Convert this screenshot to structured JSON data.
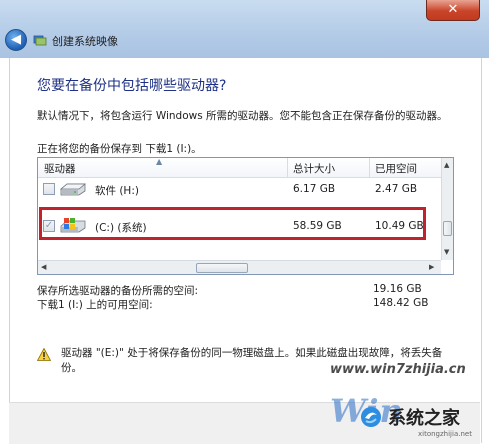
{
  "window": {
    "title": "创建系统映像",
    "close_glyph": "✕",
    "back_glyph": "◀",
    "icons": {
      "back": "back-arrow-icon",
      "app": "system-image-icon"
    }
  },
  "page": {
    "heading": "您要在备份中包括哪些驱动器?",
    "description": "默认情况下，将包含运行 Windows 所需的驱动器。您不能包含正在保存备份的驱动器。",
    "saving_to": "正在将您的备份保存到 下载1 (I:)。"
  },
  "table": {
    "columns": [
      "驱动器",
      "总计大小",
      "已用空间"
    ],
    "rows": [
      {
        "name": "软件 (H:)",
        "total": "6.17 GB",
        "used": "2.47 GB",
        "checked": false,
        "disabled": false,
        "icon": "hard-drive-icon"
      },
      {
        "name": "(C:) (系统)",
        "total": "58.59 GB",
        "used": "10.49 GB",
        "checked": true,
        "disabled": true,
        "icon": "windows-system-drive-icon"
      }
    ]
  },
  "summary": {
    "required_label": "保存所选驱动器的备份所需的空间:",
    "required_value": "19.16 GB",
    "available_label": "下载1 (I:) 上的可用空间:",
    "available_value": "148.42 GB"
  },
  "warning": {
    "text": "驱动器 \"(E:)\" 处于将保存备份的同一物理磁盘上。如果此磁盘出现故障，将丢失备份。",
    "icon": "warning-icon"
  },
  "watermark": {
    "brand": "Win",
    "url": "www.win7zhijia.cn",
    "cn": "系统之家",
    "small": "xitongzhijia.net"
  },
  "colors": {
    "heading": "#1e3287",
    "highlight": "#c0232c",
    "titlebar": "#b3cbe7"
  }
}
